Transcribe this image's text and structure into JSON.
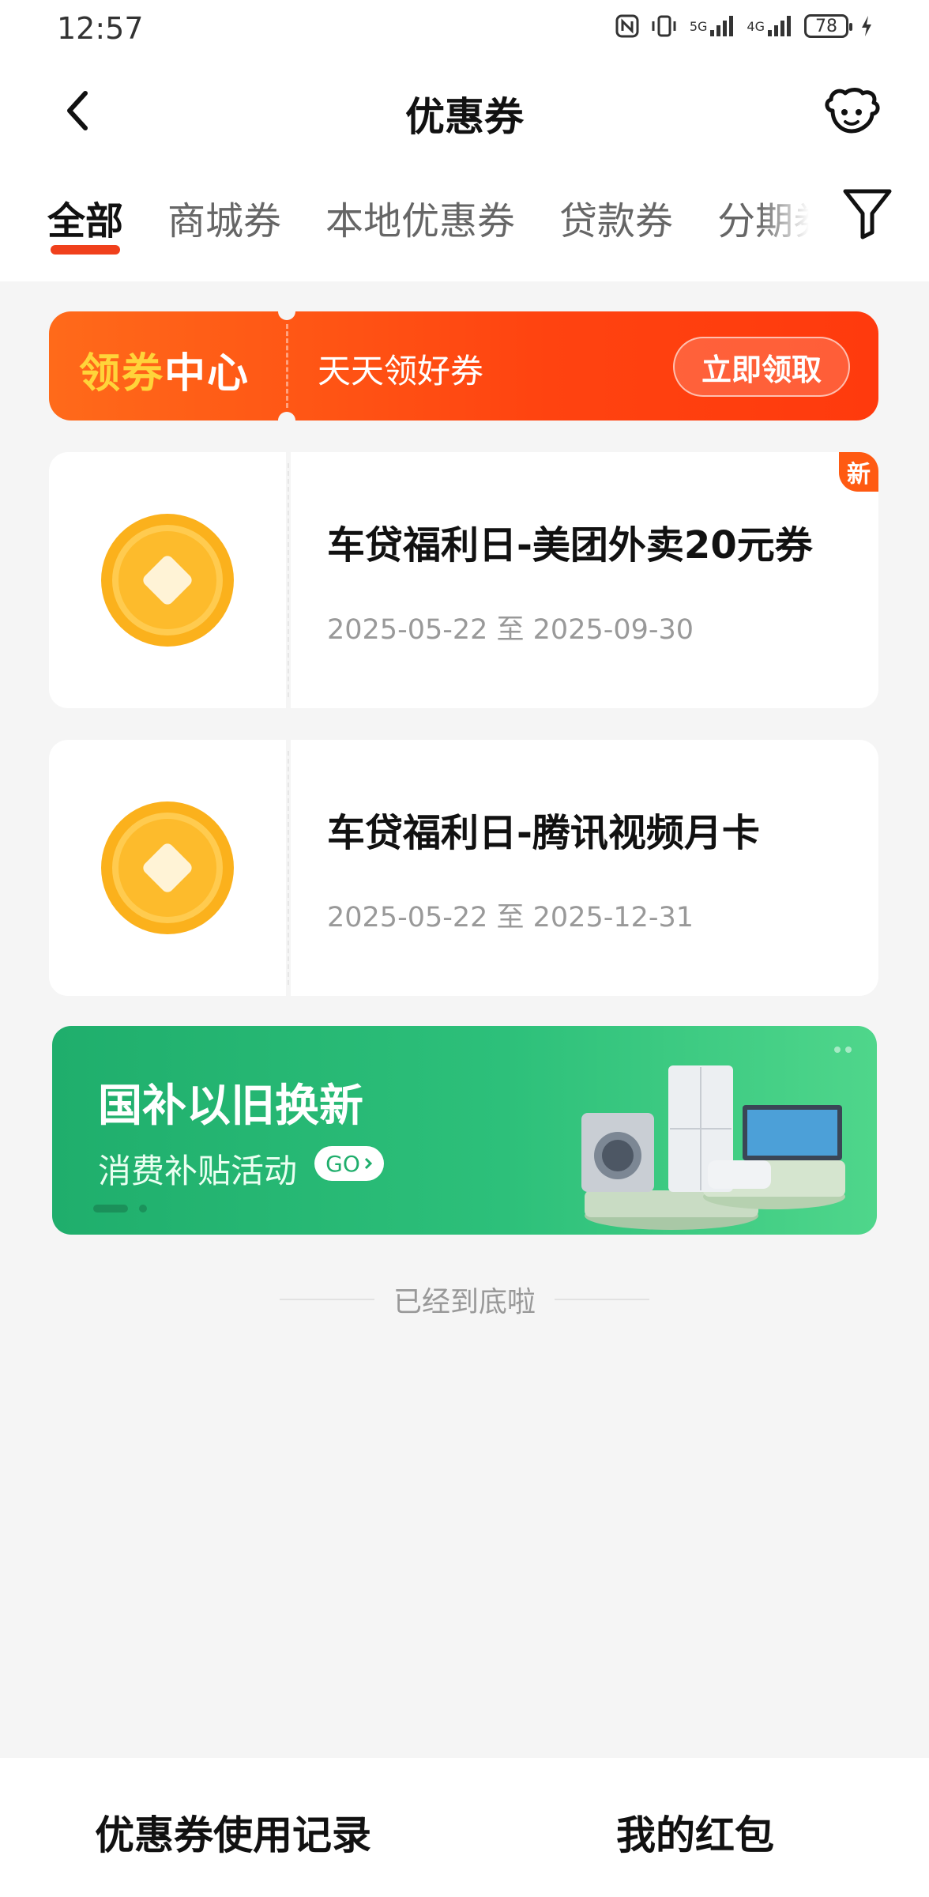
{
  "status_bar": {
    "time": "12:57",
    "battery": "78",
    "signal_5g": "5G",
    "signal_4g": "4G"
  },
  "header": {
    "title": "优惠券"
  },
  "tabs": [
    {
      "label": "全部",
      "active": true
    },
    {
      "label": "商城券",
      "active": false
    },
    {
      "label": "本地优惠券",
      "active": false
    },
    {
      "label": "贷款券",
      "active": false
    },
    {
      "label": "分期券",
      "active": false
    }
  ],
  "center_banner": {
    "title_part1": "领券",
    "title_part2": "中心",
    "slogan": "天天领好券",
    "button_label": "立即领取"
  },
  "coupons": [
    {
      "title": "车贷福利日-美团外卖20元券",
      "dates": "2025-05-22 至 2025-09-30",
      "badge": "新"
    },
    {
      "title": "车贷福利日-腾讯视频月卡",
      "dates": "2025-05-22 至 2025-12-31"
    }
  ],
  "promo_banner": {
    "title": "国补以旧换新",
    "subtitle": "消费补贴活动",
    "go_label": "GO"
  },
  "end_text": "已经到底啦",
  "bottom_bar": {
    "left_label": "优惠券使用记录",
    "right_label": "我的红包"
  },
  "colors": {
    "accent": "#f0401c",
    "banner_orange": "#ff4310",
    "coin_gold": "#fbb11c",
    "promo_green": "#2dc07a"
  }
}
